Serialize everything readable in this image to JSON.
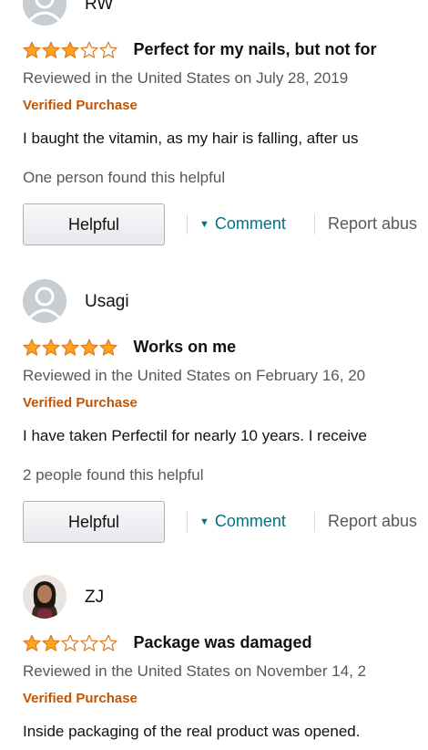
{
  "reviews": [
    {
      "author": "RW",
      "avatar_type": "default-avatar",
      "rating": 3,
      "max_rating": 5,
      "title": "Perfect for my nails, but not for",
      "meta": "Reviewed in the United States on July 28, 2019",
      "verified": "Verified Purchase",
      "body": "I baught the vitamin, as my hair is falling, after us",
      "helpful_count": "One person found this helpful",
      "helpful_label": "Helpful",
      "comment_label": "Comment",
      "report_label": "Report abus"
    },
    {
      "author": "Usagi",
      "avatar_type": "default-avatar",
      "rating": 5,
      "max_rating": 5,
      "title": "Works on me",
      "meta": "Reviewed in the United States on February 16, 20",
      "verified": "Verified Purchase",
      "body": "I have taken Perfectil for nearly 10 years. I receive",
      "helpful_count": "2 people found this helpful",
      "helpful_label": "Helpful",
      "comment_label": "Comment",
      "report_label": "Report abus"
    },
    {
      "author": "ZJ",
      "avatar_type": "photo-avatar",
      "rating": 2,
      "max_rating": 5,
      "title": "Package was damaged",
      "meta": "Reviewed in the United States on November 14, 2",
      "verified": "Verified Purchase",
      "body": "Inside packaging of the real product was opened."
    }
  ],
  "colors": {
    "star_fill": "#ffa41c",
    "star_outline": "#de7921",
    "link": "#007185",
    "verified": "#c45500",
    "secondary_text": "#565959"
  }
}
